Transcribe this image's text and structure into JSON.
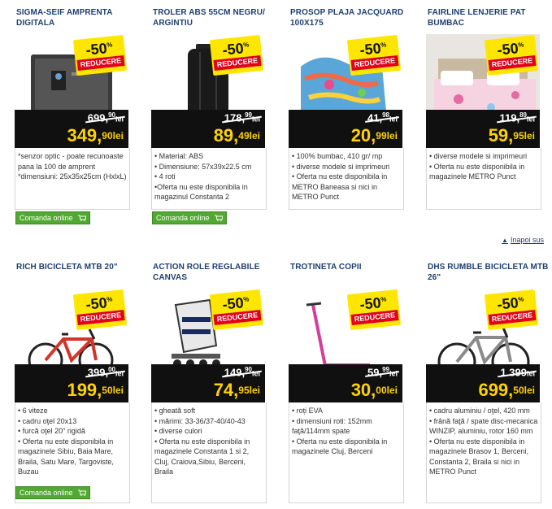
{
  "badge": {
    "percent": "-50",
    "pct_sign": "%",
    "label": "REDUCERE"
  },
  "currency": "lei",
  "order_button": "Comanda online",
  "back_to_top": "Inapoi sus",
  "colors": {
    "title": "#1e3f6e",
    "price_new": "#ffd200",
    "badge_yellow": "#ffe600",
    "badge_red": "#e2001a",
    "button_green": "#52a931"
  },
  "products": [
    {
      "title": "SIGMA-SEIF AMPRENTA DIGITALA",
      "old_int": "699",
      "old_dec": "90",
      "new_int": "349",
      "new_dec": "90",
      "desc": [
        "*senzor optic - poate recunoaste pana la 100 de amprent",
        "*dimensiuni: 25x35x25cm (HxlxL)"
      ],
      "has_button": true,
      "image": "safe"
    },
    {
      "title": "TROLER ABS 55CM negru/ argintiu",
      "old_int": "178",
      "old_dec": "99",
      "new_int": "89",
      "new_dec": "49",
      "desc": [
        "•  Material: ABS",
        "•  Dimensiune: 57x39x22.5 cm",
        "•  4 roti",
        "•Oferta nu este disponibila in magazinul Constanta 2"
      ],
      "has_button": true,
      "image": "suitcase"
    },
    {
      "title": "PROSOP PLAJA JACQUARD 100X175",
      "old_int": "41",
      "old_dec": "98",
      "new_int": "20",
      "new_dec": "99",
      "desc": [
        "•  100% bumbac, 410 gr/ mp",
        "•  diverse modele si imprimeuri",
        "•  Oferta nu este disponibila in METRO Baneasa si nici in METRO Punct"
      ],
      "has_button": false,
      "image": "towel"
    },
    {
      "title": "FAIRLINE LENJERIE PAT BUMBAC",
      "old_int": "119",
      "old_dec": "89",
      "new_int": "59",
      "new_dec": "95",
      "desc": [
        "•  diverse modele si imprimeuri",
        "•  Oferta nu este disponibila in magazinele METRO Punct"
      ],
      "has_button": false,
      "image": "bed"
    },
    {
      "title": "RICH BICICLETA MTB 20\"",
      "old_int": "399",
      "old_dec": "00",
      "new_int": "199",
      "new_dec": "50",
      "desc": [
        "• 6 viteze",
        "• cadru oţel 20x13",
        "• furcă oţel 20\" rigidă",
        "• Oferta nu este disponibila in magazinele Sibiu, Baia Mare, Braila, Satu Mare, Targoviste, Buzau"
      ],
      "has_button": true,
      "image": "bike-red"
    },
    {
      "title": "ACTION ROLE REGLABILE CANVAS",
      "old_int": "149",
      "old_dec": "90",
      "new_int": "74",
      "new_dec": "95",
      "desc": [
        "• gheată soft",
        "• mărimi: 33-36/37-40/40-43",
        "• diverse culori",
        "• Oferta nu este disponibila in magazinele Constanta 1 si 2, Cluj, Craiova,Sibiu, Berceni, Braila"
      ],
      "has_button": false,
      "image": "skates"
    },
    {
      "title": "TROTINETA COPII",
      "old_int": "59",
      "old_dec": "99",
      "new_int": "30",
      "new_dec": "00",
      "desc": [
        "• roți EVA",
        "• dimensiuni roti: 152mm faţă/114mm spate",
        "• Oferta nu este disponibila in magazinele Cluj, Berceni"
      ],
      "has_button": false,
      "image": "scooter"
    },
    {
      "title": "DHS RUMBLE BICICLETA MTB 26\"",
      "old_int": "1.399",
      "old_dec": "",
      "new_int": "699",
      "new_dec": "50",
      "desc": [
        "• cadru aluminiu / oţel, 420 mm",
        "• frână faţă / spate disc-mecanica WINZIP, aluminiu, rotor 160 mm",
        "• Oferta nu este disponibila in magazinele Brasov 1, Berceni, Constanta 2, Braila si nici in METRO Punct"
      ],
      "has_button": false,
      "image": "bike-grey"
    }
  ]
}
